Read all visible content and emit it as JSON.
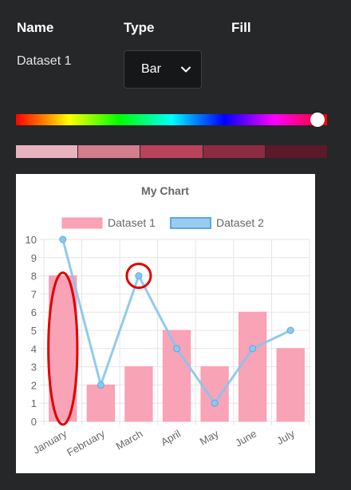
{
  "header": {
    "name_label": "Name",
    "type_label": "Type",
    "fill_label": "Fill"
  },
  "row": {
    "dataset_name": "Dataset 1",
    "type_value": "Bar"
  },
  "hue_slider": {
    "value": 0.97
  },
  "swatches": [
    "#e8b3bf",
    "#d47d8d",
    "#b8435a",
    "#8c2c41",
    "#5a1a29"
  ],
  "colors": {
    "dataset1_fill": "#f9a3b7",
    "dataset1_border": "#ff9bb0",
    "dataset2_line": "#86c4ec",
    "dataset2_fill": "#86c4ec",
    "highlight": "#e00000"
  },
  "chart_data": {
    "type": "bar",
    "title": "My Chart",
    "categories": [
      "January",
      "February",
      "March",
      "April",
      "May",
      "June",
      "July"
    ],
    "series": [
      {
        "name": "Dataset 1",
        "type": "bar",
        "values": [
          8,
          2,
          3,
          5,
          3,
          6,
          4
        ]
      },
      {
        "name": "Dataset 2",
        "type": "line",
        "values": [
          10,
          2,
          8,
          4,
          1,
          4,
          5
        ]
      }
    ],
    "ylim": [
      0,
      10
    ],
    "yticks": [
      "0",
      "1",
      "2",
      "3",
      "4",
      "5",
      "6",
      "7",
      "8",
      "9",
      "10"
    ],
    "grid": true,
    "legend": "top",
    "highlights": [
      {
        "series": "Dataset 1",
        "category": "January",
        "shape": "ellipse"
      },
      {
        "series": "Dataset 2",
        "category": "March",
        "shape": "circle"
      }
    ]
  }
}
